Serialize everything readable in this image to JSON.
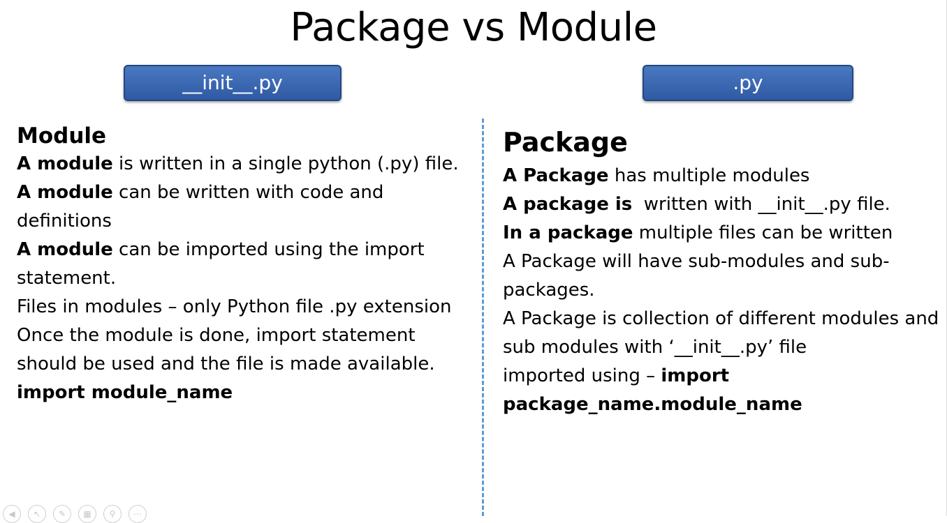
{
  "slide": {
    "title": "Package vs Module",
    "buttons": {
      "left": "__init__.py",
      "right": ".py"
    },
    "left": {
      "heading": "Module",
      "lines": [
        {
          "bold": "A module",
          "text": " is written in a single python (.py) file."
        },
        {
          "bold": "A module",
          "text": " can be written with code and definitions"
        },
        {
          "bold": "A module",
          "text": " can be imported using the import statement."
        },
        {
          "bold": "",
          "text": "Files in modules – only Python file .py extension"
        },
        {
          "bold": "",
          "text": "Once the module is done, import statement should be used and the file is made available."
        },
        {
          "bold": "import module_name",
          "text": ""
        }
      ]
    },
    "right": {
      "heading": "Package",
      "lines": [
        {
          "bold": "A Package",
          "text": " has multiple modules"
        },
        {
          "bold": "A package is",
          "text": "  written with __init__.py file."
        },
        {
          "bold": "In a package",
          "text": " multiple files can be written"
        },
        {
          "bold": "",
          "text": "A Package will have sub-modules and sub-packages."
        },
        {
          "bold": "",
          "text": "A Package is collection of different modules and sub modules with ‘__init__.py’ file"
        },
        {
          "prefix": "imported using – ",
          "bold": "import package_name.module_name",
          "text": ""
        }
      ]
    },
    "controls": [
      "prev-icon",
      "pointer-icon",
      "pen-icon",
      "slides-icon",
      "zoom-icon",
      "more-icon"
    ]
  }
}
